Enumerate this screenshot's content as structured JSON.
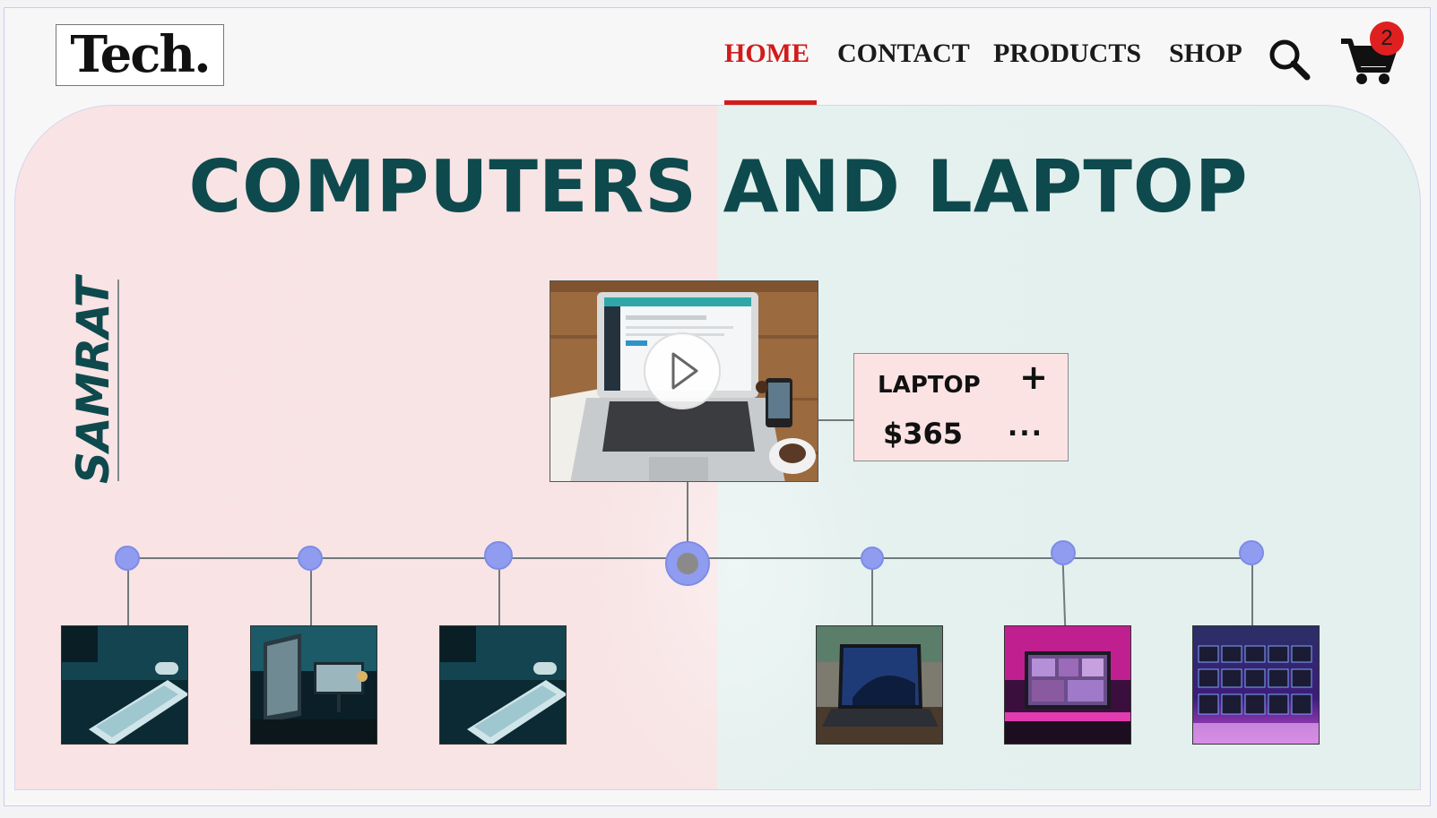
{
  "brand": {
    "logo_text": "Tech.",
    "side_text": "SAMRAT"
  },
  "nav": {
    "items": [
      {
        "label": "HOME",
        "active": true
      },
      {
        "label": "CONTACT",
        "active": false
      },
      {
        "label": "PRODUCTS",
        "active": false
      },
      {
        "label": "SHOP",
        "active": false
      }
    ],
    "search_icon": "search-icon",
    "cart_icon": "cart-icon",
    "cart_count": "2"
  },
  "hero": {
    "title": "COMPUTERS AND LAPTOP",
    "featured": {
      "media_icon": "play-icon",
      "product_name": "LAPTOP",
      "add_symbol": "+",
      "price": "$365",
      "more_symbol": "..."
    },
    "thumbnails": [
      {
        "name": "keyboard-photo"
      },
      {
        "name": "monitor-desk-photo"
      },
      {
        "name": "keyboard-photo"
      },
      {
        "name": "laptop-desk-photo"
      },
      {
        "name": "pink-workstation-photo"
      },
      {
        "name": "rgb-keyboard-photo"
      }
    ]
  },
  "colors": {
    "accent": "#d21b1b",
    "title": "#0e4a4d",
    "timeline_dot": "#8f9cf0",
    "hero_left": "#f9e3e4",
    "hero_right": "#e3f0ee"
  }
}
